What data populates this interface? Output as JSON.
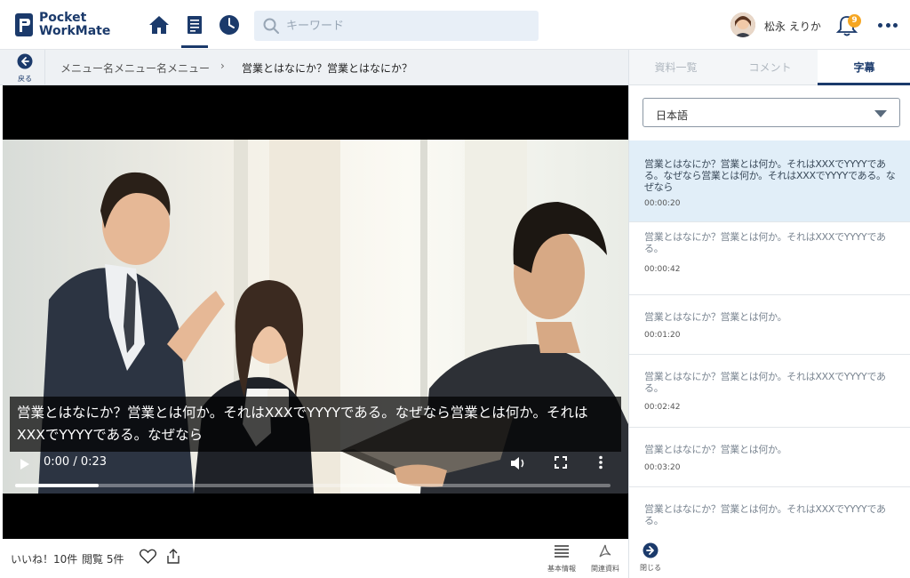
{
  "app": {
    "logo_line1": "Pocket",
    "logo_line2": "WorkMate"
  },
  "header": {
    "search_placeholder": "キーワード",
    "user_name": "松永 えりか",
    "notification_count": "9",
    "nav_icons": [
      "home-icon",
      "document-icon",
      "clock-icon"
    ]
  },
  "breadcrumb": {
    "back_label": "戻る",
    "parent": "メニュー名メニュー名メニュー",
    "current": "営業とはなにか？営業とはなにか？"
  },
  "video": {
    "caption": "営業とはなにか？営業とは何か。それはXXXでYYYYである。なぜなら営業とは何か。それはXXXでYYYYである。なぜなら",
    "time_display": "0:00 / 0:23",
    "progress": 0.14
  },
  "footer": {
    "likes": "いいね！10件",
    "views": "閲覧 5件",
    "basic_info_label": "基本情報",
    "related_label": "関連資料"
  },
  "panel": {
    "tabs": [
      {
        "label": "資料一覧",
        "active": false
      },
      {
        "label": "コメント",
        "active": false
      },
      {
        "label": "字幕",
        "active": true
      }
    ],
    "language": "日本語",
    "subtitles": [
      {
        "text": "営業とはなにか？営業とは何か。それはXXXでYYYYである。なぜなら営業とは何か。それはXXXでYYYYである。なぜなら",
        "time": "00:00:20",
        "active": true
      },
      {
        "text": "営業とはなにか？営業とは何か。それはXXXでYYYYである。",
        "time": "00:00:42",
        "active": false
      },
      {
        "text": "営業とはなにか？営業とは何か。",
        "time": "00:01:20",
        "active": false
      },
      {
        "text": "営業とはなにか？営業とは何か。それはXXXでYYYYである。",
        "time": "00:02:42",
        "active": false
      },
      {
        "text": "営業とはなにか？営業とは何か。",
        "time": "00:03:20",
        "active": false
      },
      {
        "text": "営業とはなにか？営業とは何か。それはXXXでYYYYである。",
        "time": "",
        "active": false
      }
    ],
    "close_label": "閉じる"
  },
  "colors": {
    "brand": "#1b3a6b",
    "badge": "#f5a623",
    "active_subtitle_bg": "#e1eef8"
  }
}
